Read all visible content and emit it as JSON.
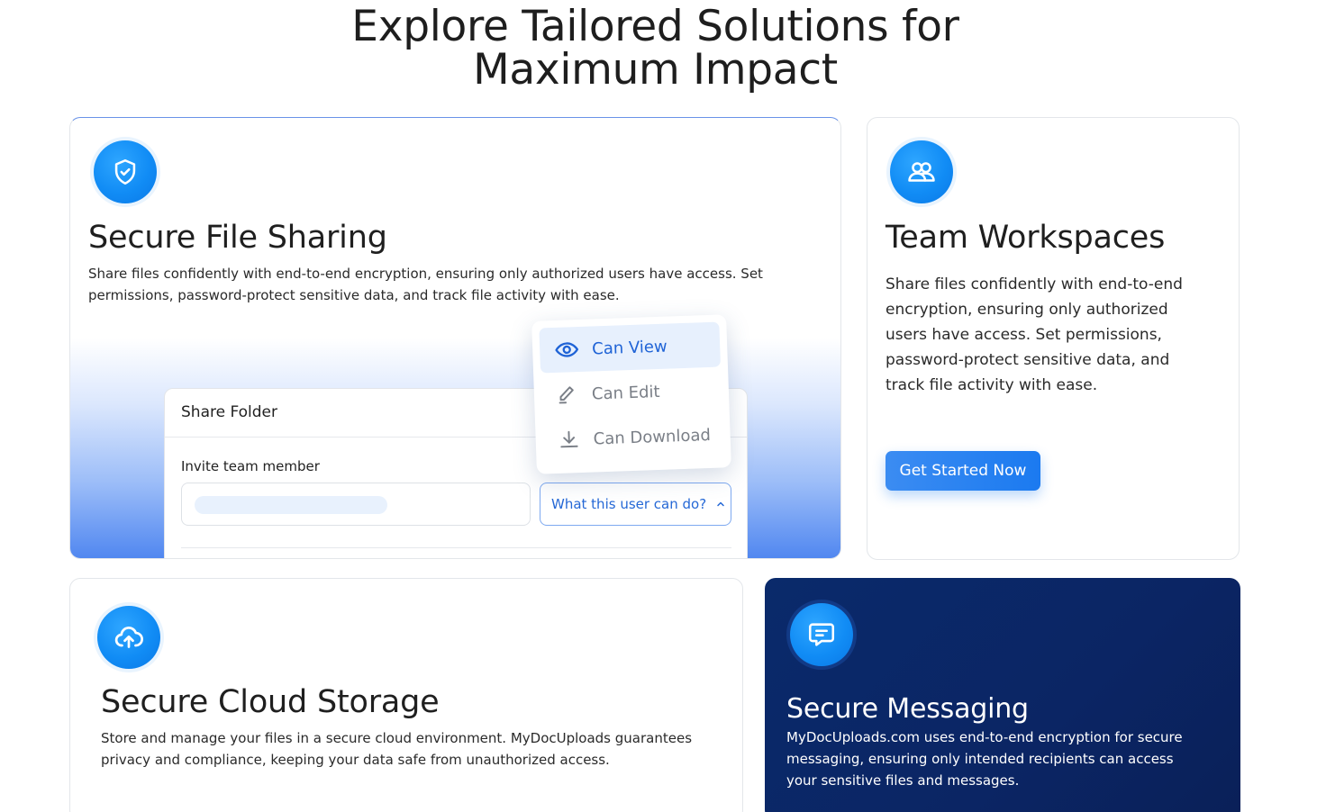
{
  "heading": {
    "line1": "Explore Tailored Solutions for",
    "line2": "Maximum Impact"
  },
  "cards": [
    {
      "title": "Secure File Sharing",
      "description": "Share files confidently with end-to-end encryption, ensuring only authorized users have access. Set permissions, password-protect sensitive data, and track file activity with ease.",
      "icon": "shield-check-icon",
      "illustration": {
        "panel_title": "Share Folder",
        "invite_label": "Invite team member",
        "permission_select": "What this user can do?",
        "options": [
          "Can View",
          "Can Edit",
          "Can Download"
        ],
        "selected_option": "Can View"
      }
    },
    {
      "title": "Team Workspaces",
      "description": "Share files confidently with end-to-end encryption, ensuring only authorized users have access. Set permissions, password-protect sensitive data, and track file activity with ease.",
      "icon": "users-icon",
      "button": "Get Started Now"
    },
    {
      "title": "Secure Cloud Storage",
      "description": "Store and manage your files in a secure cloud environment. MyDocUploads guarantees privacy and compliance, keeping your data safe from unauthorized access.",
      "icon": "cloud-upload-icon"
    },
    {
      "title": "Secure Messaging",
      "description": "MyDocUploads.com uses end-to-end encryption for secure messaging, ensuring only intended recipients can access your sensitive files and messages.",
      "icon": "message-icon"
    }
  ],
  "colors": {
    "accent": "#118cf5",
    "dark_card": "#0b2564",
    "link_blue": "#2568d6"
  }
}
